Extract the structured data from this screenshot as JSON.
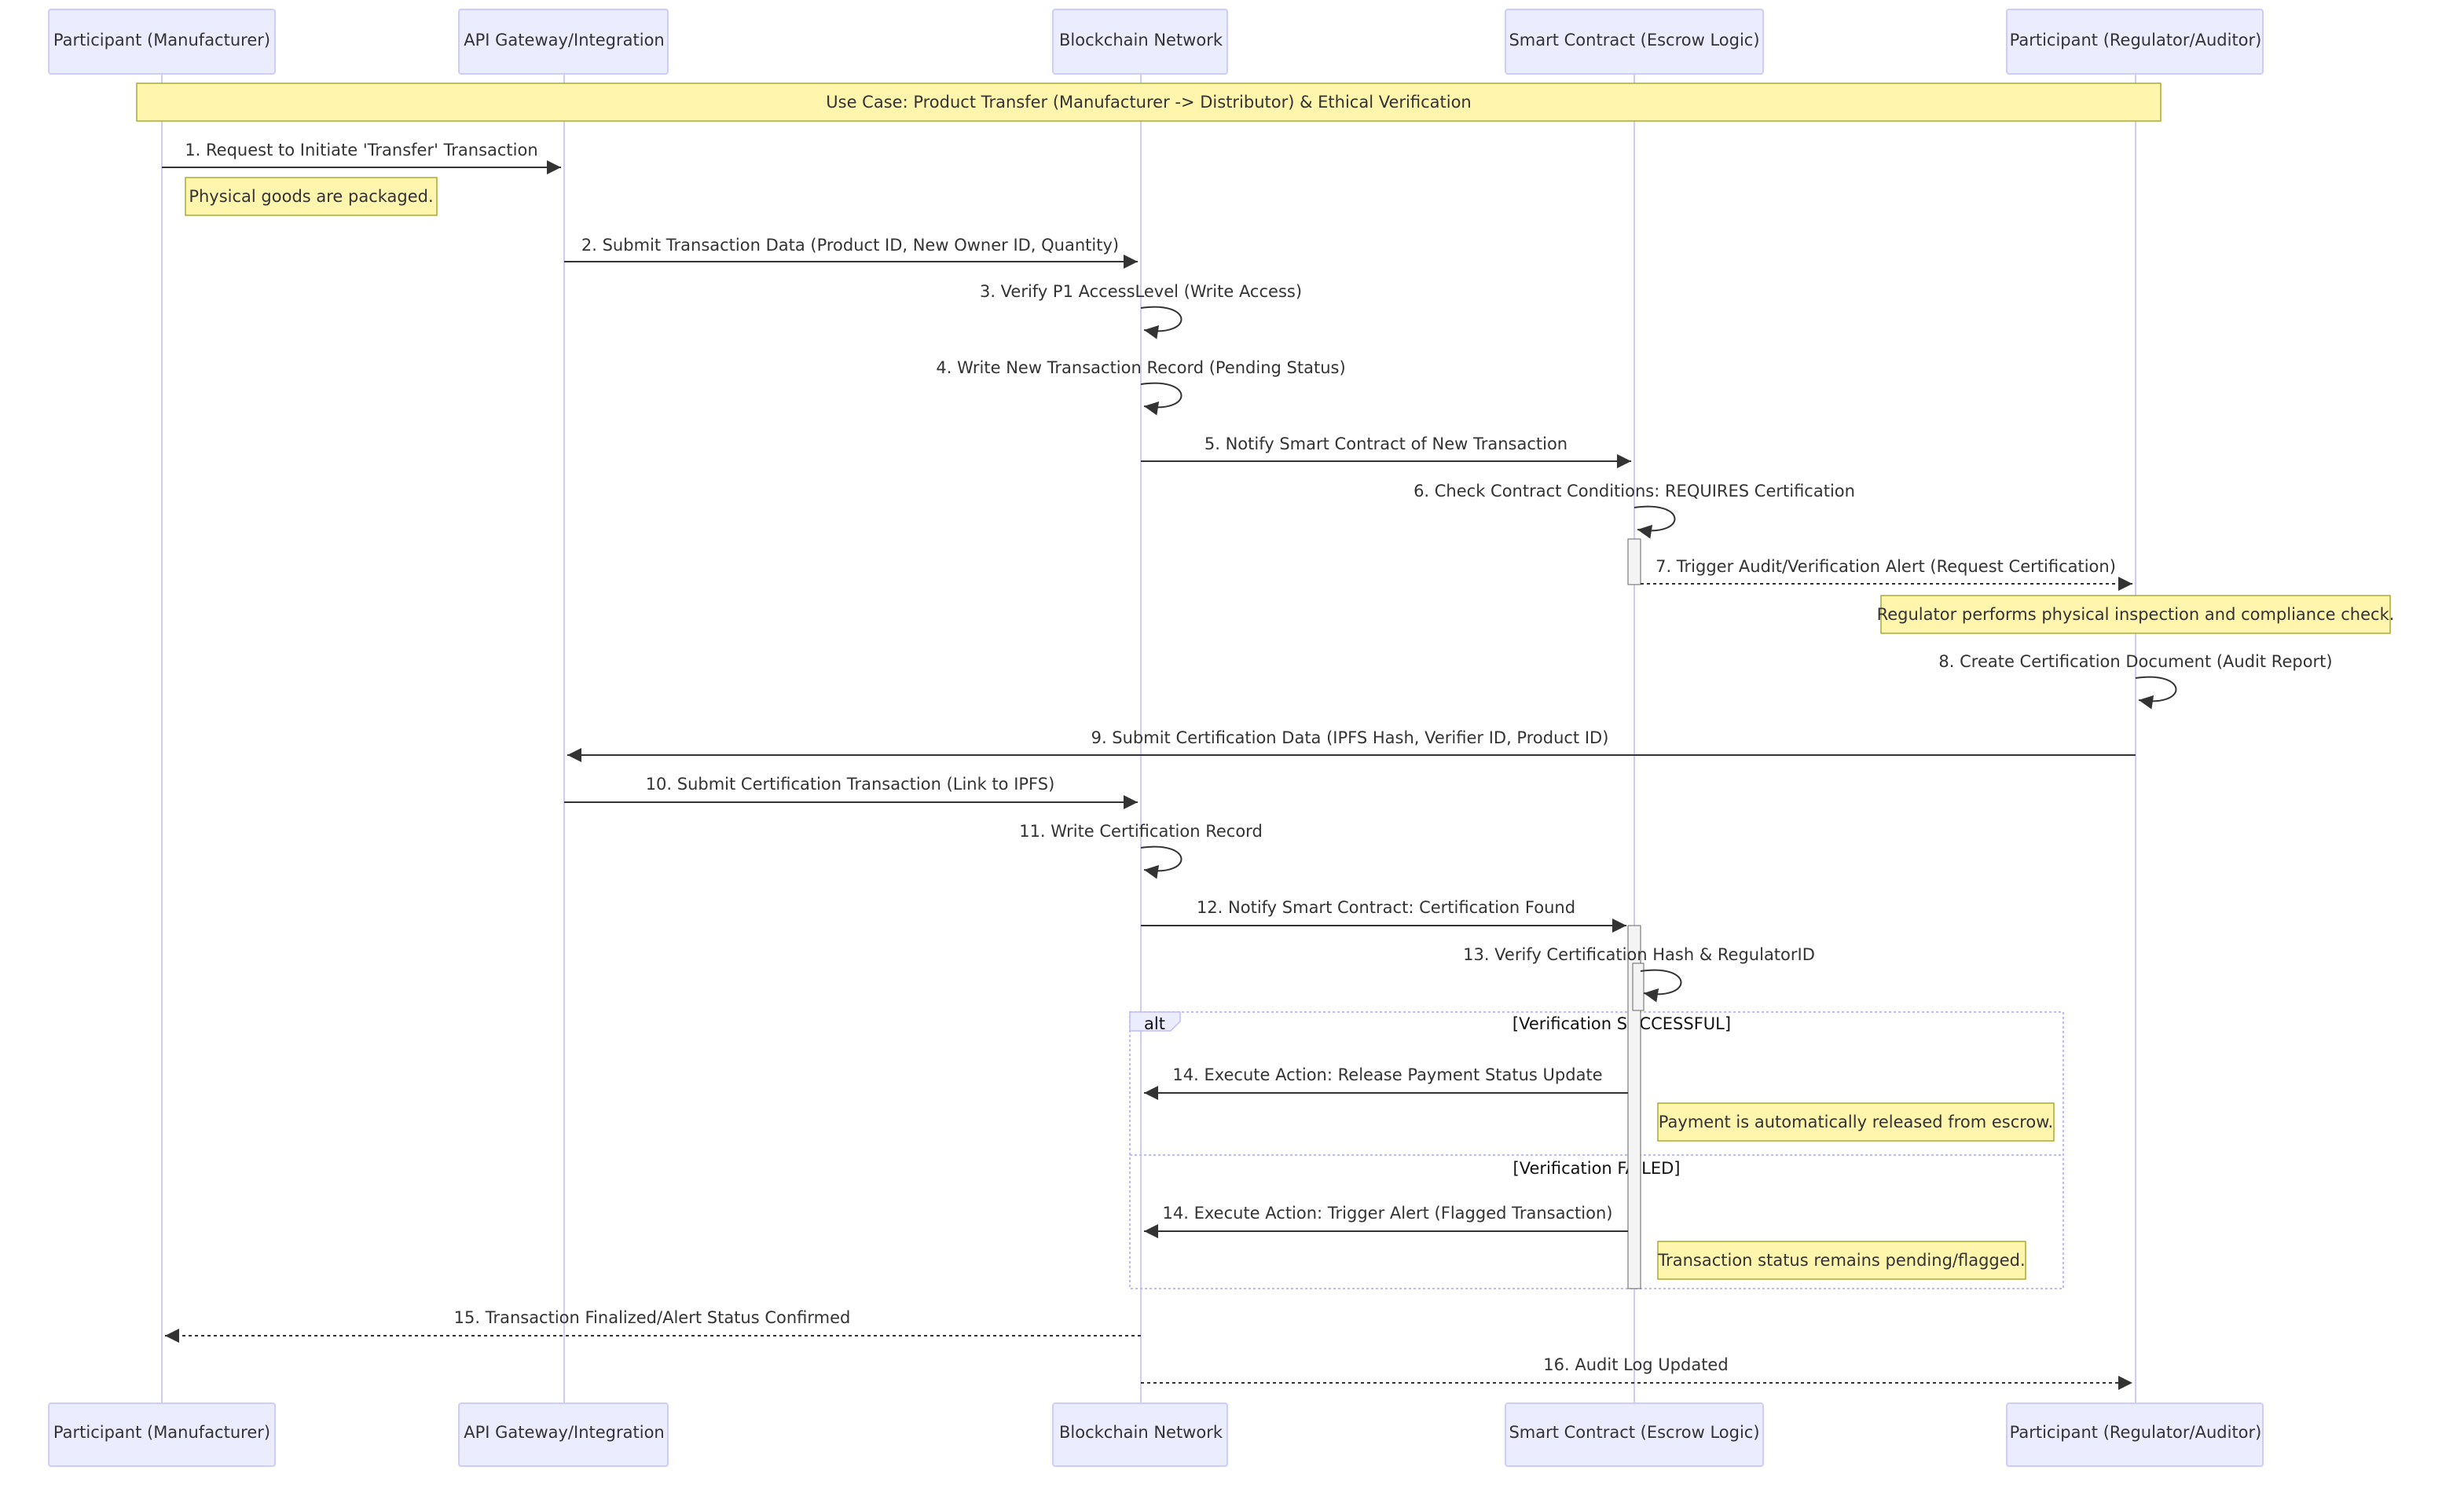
{
  "actors": [
    {
      "id": "manufacturer",
      "label": "Participant (Manufacturer)"
    },
    {
      "id": "gateway",
      "label": "API Gateway/Integration"
    },
    {
      "id": "blockchain",
      "label": "Blockchain Network"
    },
    {
      "id": "contract",
      "label": "Smart Contract (Escrow Logic)"
    },
    {
      "id": "regulator",
      "label": "Participant (Regulator/Auditor)"
    }
  ],
  "notes": [
    {
      "text": "Use Case: Product Transfer (Manufacturer -> Distributor) & Ethical Verification"
    },
    {
      "text": "Physical goods are packaged."
    },
    {
      "text": "Regulator performs physical inspection and compliance check."
    },
    {
      "text": "Payment is automatically released from escrow."
    },
    {
      "text": "Transaction status remains pending/flagged."
    }
  ],
  "messages": [
    {
      "from": "manufacturer",
      "to": "gateway",
      "style": "solid",
      "text": "1. Request to Initiate 'Transfer' Transaction"
    },
    {
      "from": "gateway",
      "to": "blockchain",
      "style": "solid",
      "text": "2. Submit Transaction Data (Product ID, New Owner ID, Quantity)"
    },
    {
      "from": "blockchain",
      "to": "blockchain",
      "style": "self",
      "text": "3. Verify P1 AccessLevel (Write Access)"
    },
    {
      "from": "blockchain",
      "to": "blockchain",
      "style": "self",
      "text": "4. Write New Transaction Record (Pending Status)"
    },
    {
      "from": "blockchain",
      "to": "contract",
      "style": "solid",
      "text": "5. Notify Smart Contract of New Transaction"
    },
    {
      "from": "contract",
      "to": "contract",
      "style": "self",
      "text": "6. Check Contract Conditions: REQUIRES Certification"
    },
    {
      "from": "contract",
      "to": "regulator",
      "style": "dotted",
      "text": "7. Trigger Audit/Verification Alert (Request Certification)"
    },
    {
      "from": "regulator",
      "to": "regulator",
      "style": "self",
      "text": "8. Create Certification Document (Audit Report)"
    },
    {
      "from": "regulator",
      "to": "gateway",
      "style": "solid",
      "text": "9. Submit Certification Data (IPFS Hash, Verifier ID, Product ID)"
    },
    {
      "from": "gateway",
      "to": "blockchain",
      "style": "solid",
      "text": "10. Submit Certification Transaction (Link to IPFS)"
    },
    {
      "from": "blockchain",
      "to": "blockchain",
      "style": "self",
      "text": "11. Write Certification Record"
    },
    {
      "from": "blockchain",
      "to": "contract",
      "style": "solid",
      "text": "12. Notify Smart Contract: Certification Found"
    },
    {
      "from": "contract",
      "to": "contract",
      "style": "self",
      "text": "13. Verify Certification Hash & RegulatorID"
    },
    {
      "from": "contract",
      "to": "blockchain",
      "style": "solid",
      "text": "14. Execute Action: Release Payment Status Update"
    },
    {
      "from": "contract",
      "to": "blockchain",
      "style": "solid",
      "text": "14. Execute Action: Trigger Alert (Flagged Transaction)"
    },
    {
      "from": "blockchain",
      "to": "manufacturer",
      "style": "dotted",
      "text": "15. Transaction Finalized/Alert Status Confirmed"
    },
    {
      "from": "blockchain",
      "to": "regulator",
      "style": "dotted",
      "text": "16. Audit Log Updated"
    }
  ],
  "alt_block": {
    "keyword": "alt",
    "conditions": [
      "[Verification SUCCESSFUL]",
      "[Verification FAILED]"
    ]
  },
  "colors": {
    "actor_fill": "#ECECFF",
    "actor_border": "#CCCCFF",
    "lifeline": "#CCCCFF",
    "note_fill": "#FFF5AD",
    "note_border": "#AAAA33",
    "arrow": "#333333",
    "activation_fill": "#F4F4F4",
    "activation_border": "#666666",
    "alt_border": "#BBBBFF"
  }
}
